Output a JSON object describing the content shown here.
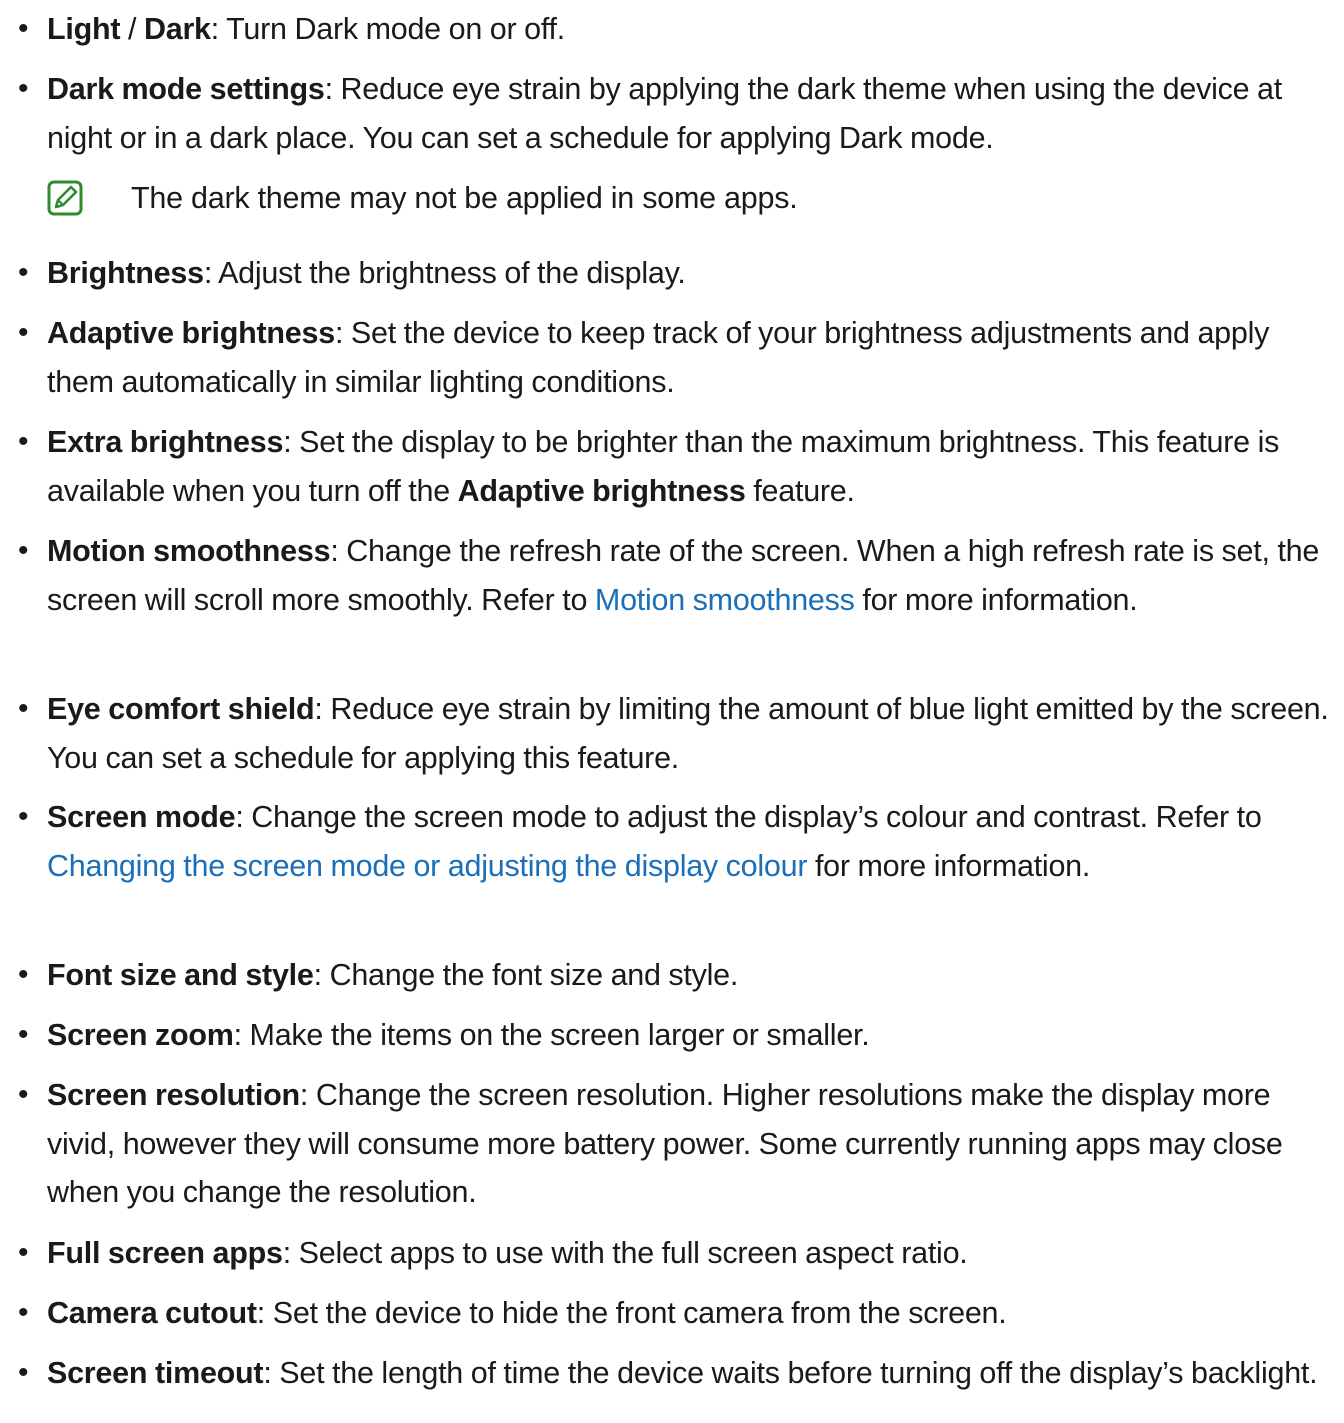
{
  "colors": {
    "text": "#1a1a1a",
    "link": "#1a6fb8",
    "note_icon": "#2e8b2e"
  },
  "bullet_glyph": "•",
  "items": [
    {
      "term": "Light",
      "sep": " / ",
      "term2": "Dark",
      "desc": ": Turn Dark mode on or off."
    },
    {
      "term": "Dark mode settings",
      "desc": ": Reduce eye strain by applying the dark theme when using the device at night or in a dark place. You can set a schedule for applying Dark mode."
    },
    {
      "term": "Brightness",
      "desc": ": Adjust the brightness of the display."
    },
    {
      "term": "Adaptive brightness",
      "desc": ": Set the device to keep track of your brightness adjustments and apply them automatically in similar lighting conditions."
    },
    {
      "term": "Extra brightness",
      "desc": ": Set the display to be brighter than the maximum brightness. This feature is available when you turn off the ",
      "inline_bold": "Adaptive brightness",
      "desc_after": " feature."
    },
    {
      "term": "Motion smoothness",
      "desc": ": Change the refresh rate of the screen. When a high refresh rate is set, the screen will scroll more smoothly. Refer to ",
      "link": "Motion smoothness",
      "desc_after": " for more information."
    },
    {
      "term": "Eye comfort shield",
      "desc": ": Reduce eye strain by limiting the amount of blue light emitted by the screen. You can set a schedule for applying this feature."
    },
    {
      "term": "Screen mode",
      "desc": ": Change the screen mode to adjust the display’s colour and contrast. Refer to ",
      "link": "Changing the screen mode or adjusting the display colour",
      "desc_after": " for more information."
    },
    {
      "term": "Font size and style",
      "desc": ": Change the font size and style."
    },
    {
      "term": "Screen zoom",
      "desc": ": Make the items on the screen larger or smaller."
    },
    {
      "term": "Screen resolution",
      "desc": ": Change the screen resolution. Higher resolutions make the display more vivid, however they will consume more battery power. Some currently running apps may close when you change the resolution."
    },
    {
      "term": "Full screen apps",
      "desc": ": Select apps to use with the full screen aspect ratio."
    },
    {
      "term": "Camera cutout",
      "desc": ": Set the device to hide the front camera from the screen."
    },
    {
      "term": "Screen timeout",
      "desc": ": Set the length of time the device waits before turning off the display’s backlight."
    }
  ],
  "note": {
    "icon": "note-pencil-icon",
    "text": "The dark theme may not be applied in some apps."
  }
}
